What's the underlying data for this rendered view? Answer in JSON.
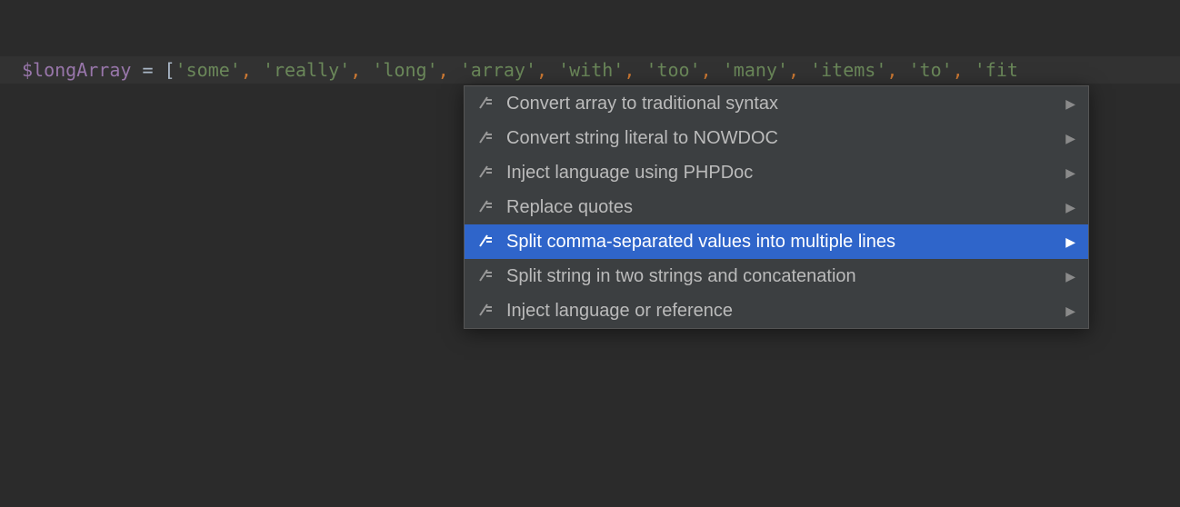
{
  "code": {
    "var": "$longArray",
    "eq": " = ",
    "lbracket": "[",
    "items": [
      "'some'",
      "'really'",
      "'long'",
      "'array'",
      "'with'",
      "'too'",
      "'many'",
      "'items'",
      "'to'",
      "'fit"
    ],
    "comma": ","
  },
  "menu": {
    "items": [
      {
        "label": "Convert array to traditional syntax",
        "selected": false,
        "submenu": true
      },
      {
        "label": "Convert string literal to NOWDOC",
        "selected": false,
        "submenu": true
      },
      {
        "label": "Inject language using PHPDoc",
        "selected": false,
        "submenu": true
      },
      {
        "label": "Replace quotes",
        "selected": false,
        "submenu": true
      },
      {
        "label": "Split comma-separated values into multiple lines",
        "selected": true,
        "submenu": true
      },
      {
        "label": "Split string in two strings and concatenation",
        "selected": false,
        "submenu": true
      },
      {
        "label": "Inject language or reference",
        "selected": false,
        "submenu": true
      }
    ]
  }
}
